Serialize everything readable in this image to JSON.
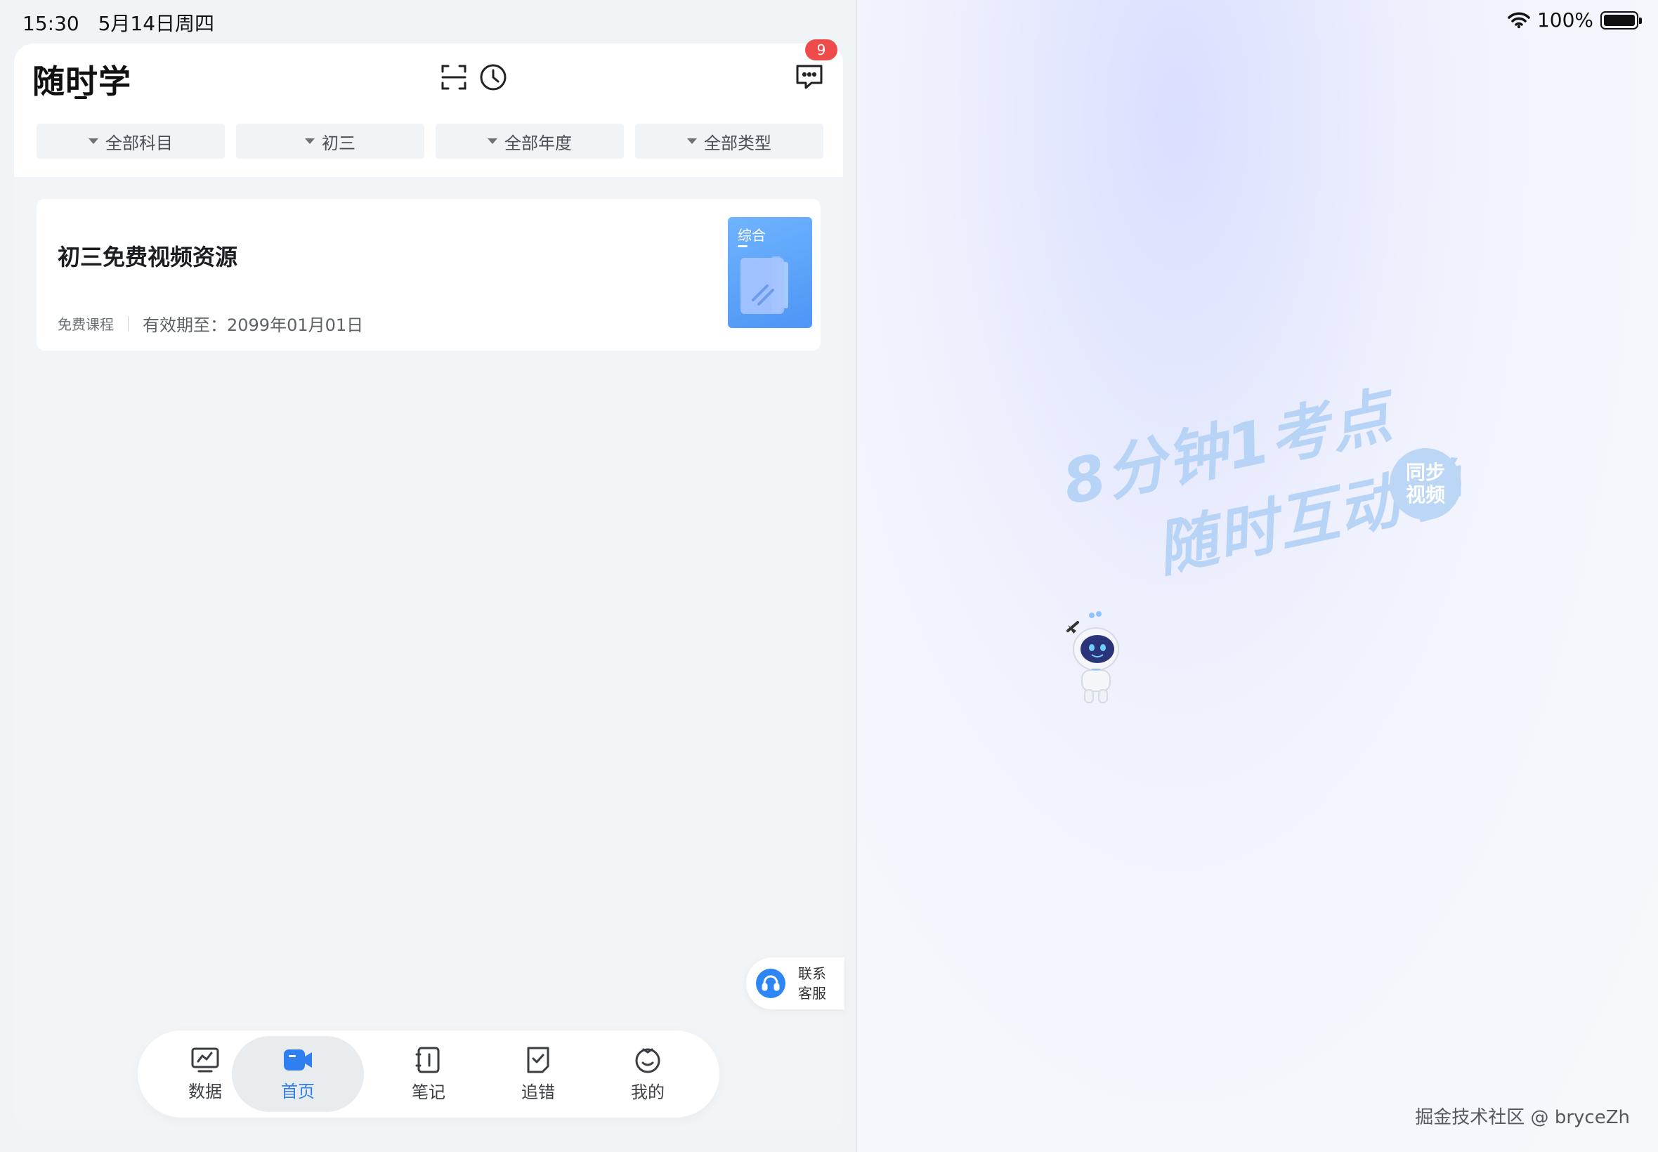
{
  "status_bar": {
    "time": "15:30",
    "date": "5月14日周四",
    "battery": "100%",
    "icons": [
      "wifi-icon",
      "battery-icon"
    ]
  },
  "header": {
    "title": "随时学",
    "icons": [
      "scan-icon",
      "history-clock-icon",
      "message-icon"
    ],
    "message_badge": "9"
  },
  "filters": [
    {
      "label": "全部科目"
    },
    {
      "label": "初三"
    },
    {
      "label": "全部年度"
    },
    {
      "label": "全部类型"
    }
  ],
  "course": {
    "title": "初三免费视频资源",
    "tag": "免费课程",
    "expiry": "有效期至：2099年01月01日",
    "thumb_label": "综合"
  },
  "service": {
    "line1": "联系",
    "line2": "客服"
  },
  "tabbar": {
    "tabs": [
      {
        "label": "数据",
        "icon": "chart-icon"
      },
      {
        "label": "首页",
        "icon": "video-camera-icon"
      },
      {
        "label": "笔记",
        "icon": "notebook-icon"
      },
      {
        "label": "追错",
        "icon": "check-note-icon"
      },
      {
        "label": "我的",
        "icon": "profile-face-icon"
      }
    ],
    "active_index": 1
  },
  "splash": {
    "slogan_line1": "8分钟1考点",
    "slogan_line2": "随时互动学",
    "badge_line1": "同步",
    "badge_line2": "视频",
    "watermark": "掘金技术社区 @ bryceZh"
  },
  "colors": {
    "accent": "#2f7ff0",
    "badge_red": "#f04b4b",
    "slogan": "#b7d4f6"
  }
}
